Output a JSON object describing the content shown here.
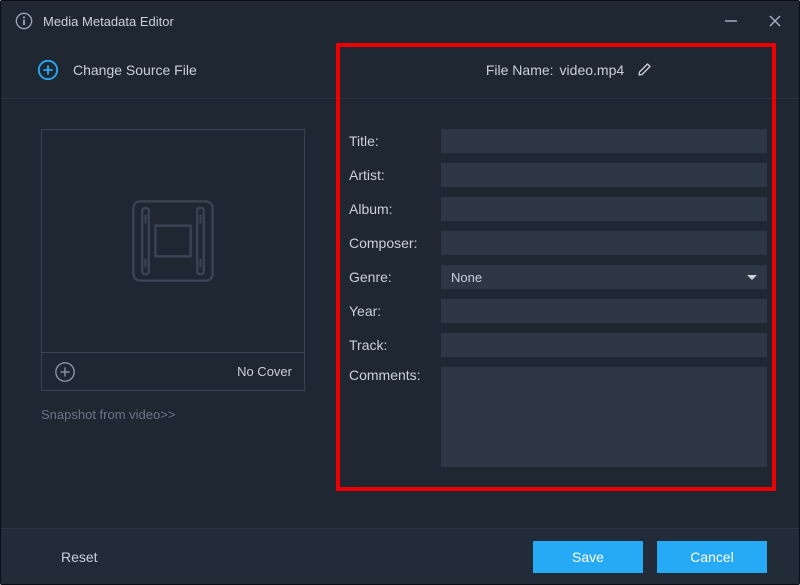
{
  "window": {
    "title": "Media Metadata Editor"
  },
  "source": {
    "change_label": "Change Source File"
  },
  "filename": {
    "label": "File Name:",
    "value": "video.mp4"
  },
  "cover": {
    "no_cover_label": "No Cover",
    "snapshot_link": "Snapshot from video>>"
  },
  "fields": {
    "title": {
      "label": "Title:",
      "value": ""
    },
    "artist": {
      "label": "Artist:",
      "value": ""
    },
    "album": {
      "label": "Album:",
      "value": ""
    },
    "composer": {
      "label": "Composer:",
      "value": ""
    },
    "genre": {
      "label": "Genre:",
      "value": "None"
    },
    "year": {
      "label": "Year:",
      "value": ""
    },
    "track": {
      "label": "Track:",
      "value": ""
    },
    "comments": {
      "label": "Comments:",
      "value": ""
    }
  },
  "footer": {
    "reset": "Reset",
    "save": "Save",
    "cancel": "Cancel"
  },
  "colors": {
    "accent": "#26aaf5",
    "highlight": "#ee0000",
    "background": "#1f2733",
    "input_bg": "#2e3745"
  }
}
